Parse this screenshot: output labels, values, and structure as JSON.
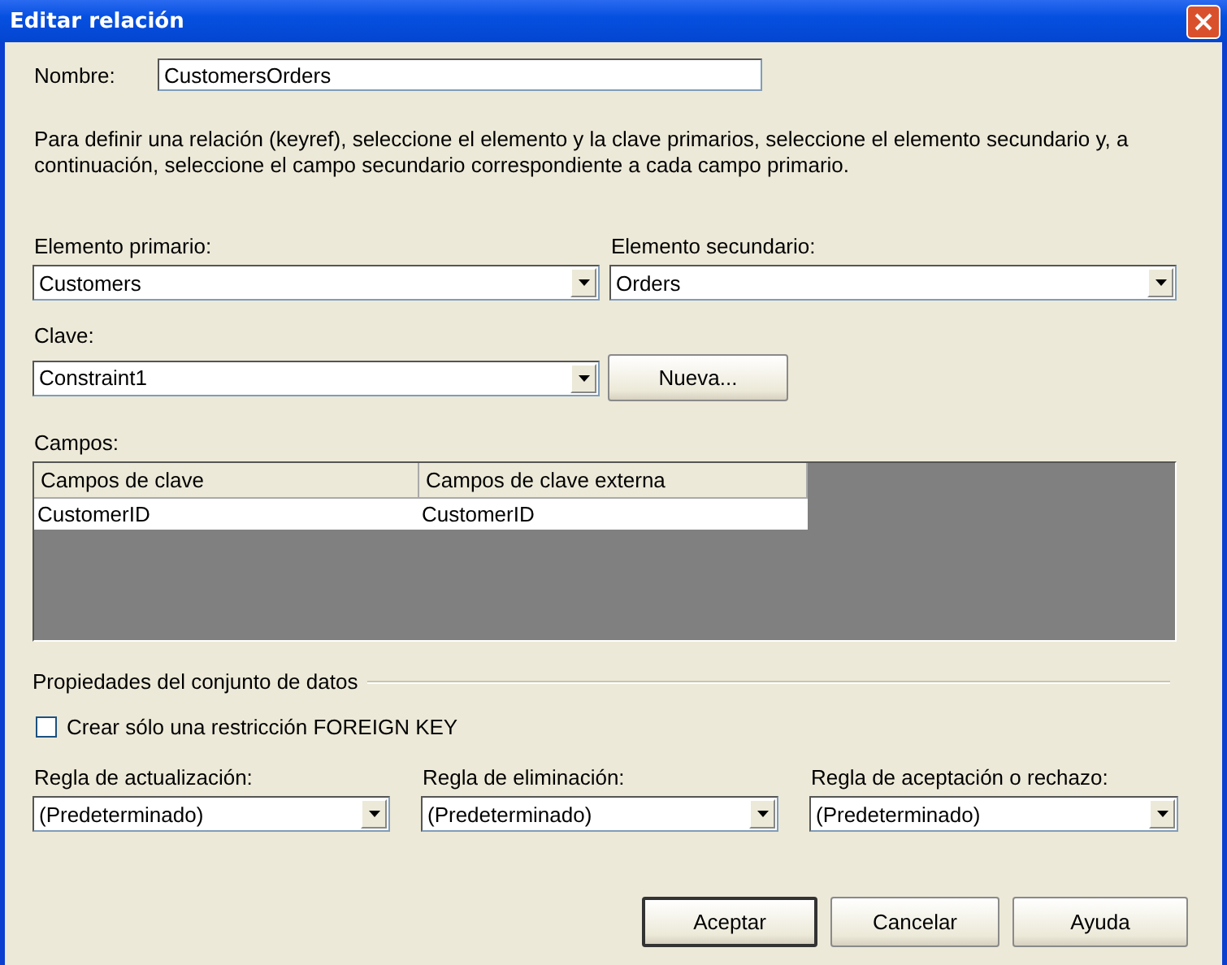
{
  "window": {
    "title": "Editar relación"
  },
  "name_field": {
    "label": "Nombre:",
    "value": "CustomersOrders"
  },
  "description": "Para definir una relación (keyref), seleccione el elemento y la clave primarios, seleccione el elemento secundario y, a continuación, seleccione el campo secundario correspondiente a cada campo primario.",
  "primary_element": {
    "label": "Elemento primario:",
    "value": "Customers"
  },
  "secondary_element": {
    "label": "Elemento secundario:",
    "value": "Orders"
  },
  "key": {
    "label": "Clave:",
    "value": "Constraint1"
  },
  "new_button": {
    "label": "Nueva..."
  },
  "fields": {
    "label": "Campos:",
    "columns": [
      "Campos de clave",
      "Campos de clave externa"
    ],
    "rows": [
      [
        "CustomerID",
        "CustomerID"
      ]
    ]
  },
  "group": {
    "title": "Propiedades del conjunto de datos"
  },
  "checkbox": {
    "label": "Crear sólo una restricción FOREIGN KEY",
    "checked": false
  },
  "rules": [
    {
      "label": "Regla de actualización:",
      "value": "(Predeterminado)"
    },
    {
      "label": "Regla de eliminación:",
      "value": "(Predeterminado)"
    },
    {
      "label": "Regla de aceptación o rechazo:",
      "value": "(Predeterminado)"
    }
  ],
  "buttons": [
    {
      "label": "Aceptar",
      "default": true
    },
    {
      "label": "Cancelar",
      "default": false
    },
    {
      "label": "Ayuda",
      "default": false
    }
  ]
}
